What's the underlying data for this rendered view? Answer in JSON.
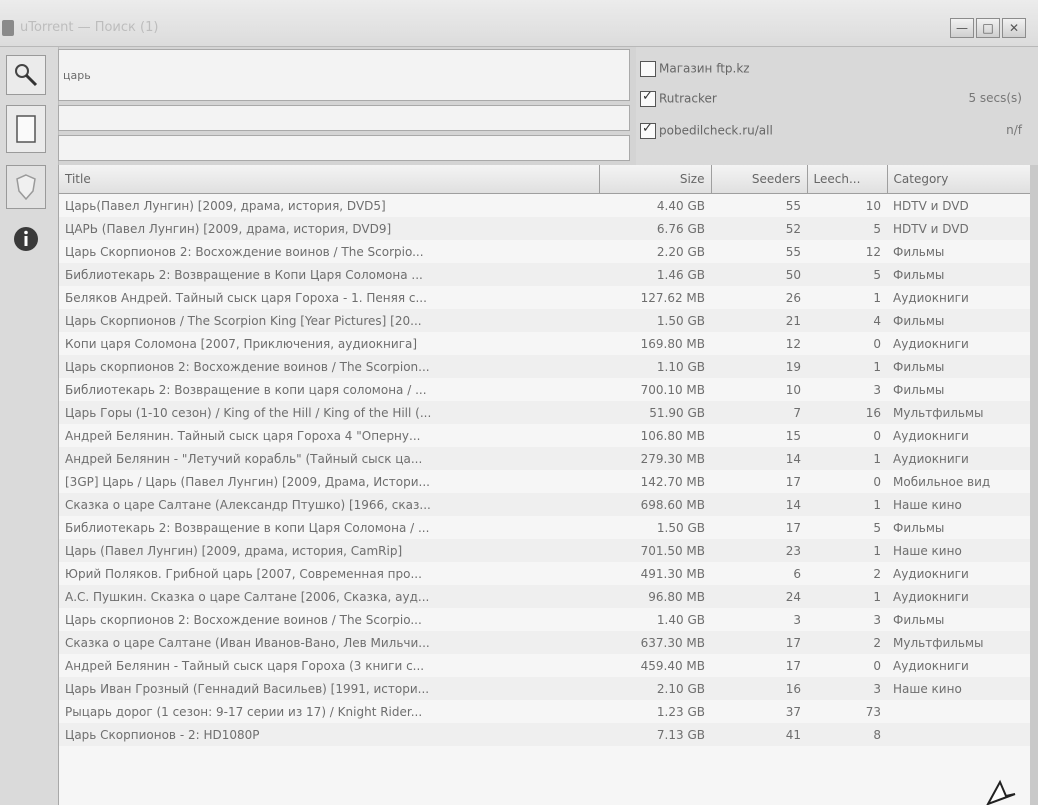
{
  "window": {
    "title": "uTorrent — Поиск (1)",
    "buttons": [
      "—",
      "□",
      "✕"
    ]
  },
  "toolbar": {
    "icons": [
      "search-icon",
      "page-icon",
      "shield-icon",
      "info-icon"
    ]
  },
  "search": {
    "query": "царь",
    "second_field": "",
    "third_field": ""
  },
  "options": {
    "items": [
      {
        "label": "Магазин ftp.kz",
        "checked": false,
        "right": ""
      },
      {
        "label": "Rutracker",
        "checked": true,
        "right": "5 secs(s)"
      },
      {
        "label": "pobedilcheck.ru/all",
        "checked": true,
        "right": "n/f"
      }
    ]
  },
  "table": {
    "columns": [
      "Title",
      "Size",
      "Seeders",
      "Leech...",
      "Category"
    ],
    "rows": [
      [
        "Царь(Павел Лунгин) [2009, драма, история, DVD5]",
        "4.40 GB",
        "55",
        "10",
        "HDTV и DVD"
      ],
      [
        "ЦАРЬ (Павел Лунгин) [2009, драма, история, DVD9]",
        "6.76 GB",
        "52",
        "5",
        "HDTV и DVD"
      ],
      [
        "Царь Скорпионов 2: Восхождение воинов / The Scorpio...",
        "2.20 GB",
        "55",
        "12",
        "Фильмы"
      ],
      [
        "Библиотекарь 2: Возвращение в Копи Царя Соломона ...",
        "1.46 GB",
        "50",
        "5",
        "Фильмы"
      ],
      [
        "Беляков Андрей. Тайный сыск царя Гороха - 1. Пеняя с...",
        "127.62 MB",
        "26",
        "1",
        "Аудиокниги"
      ],
      [
        "Царь Скорпионов / The Scorpion King [Year Pictures] [20...",
        "1.50 GB",
        "21",
        "4",
        "Фильмы"
      ],
      [
        "Копи царя Соломона [2007, Приключения, аудиокнига]",
        "169.80 MB",
        "12",
        "0",
        "Аудиокниги"
      ],
      [
        "Царь скорпионов 2: Восхождение воинов / The Scorpion...",
        "1.10 GB",
        "19",
        "1",
        "Фильмы"
      ],
      [
        "Библиотекарь 2: Возвращение в копи царя соломона / ...",
        "700.10 MB",
        "10",
        "3",
        "Фильмы"
      ],
      [
        "Царь Горы (1-10 сезон) / King of the Hill / King of the Hill (...",
        "51.90 GB",
        "7",
        "16",
        "Мультфильмы"
      ],
      [
        "Андрей Белянин. Тайный сыск царя Гороха 4 \"Оперну...",
        "106.80 MB",
        "15",
        "0",
        "Аудиокниги"
      ],
      [
        "Андрей Белянин - \"Летучий корабль\" (Тайный сыск ца...",
        "279.30 MB",
        "14",
        "1",
        "Аудиокниги"
      ],
      [
        "[3GP] Царь / Царь (Павел Лунгин) [2009, Драма, Истори...",
        "142.70 MB",
        "17",
        "0",
        "Мобильное вид"
      ],
      [
        "Сказка о царе Салтане (Александр Птушко) [1966, сказ...",
        "698.60 MB",
        "14",
        "1",
        "Наше кино"
      ],
      [
        "Библиотекарь 2: Возвращение в копи Царя Соломона / ...",
        "1.50 GB",
        "17",
        "5",
        "Фильмы"
      ],
      [
        "Царь (Павел Лунгин) [2009, драма, история, CamRip]",
        "701.50 MB",
        "23",
        "1",
        "Наше кино"
      ],
      [
        "Юрий Поляков. Грибной царь [2007, Современная про...",
        "491.30 MB",
        "6",
        "2",
        "Аудиокниги"
      ],
      [
        "А.С. Пушкин. Сказка о царе Салтане [2006, Сказка, ауд...",
        "96.80 MB",
        "24",
        "1",
        "Аудиокниги"
      ],
      [
        "Царь скорпионов 2: Восхождение воинов / The Scorpio...",
        "1.40 GB",
        "3",
        "3",
        "Фильмы"
      ],
      [
        "Сказка о царе Салтане (Иван Иванов-Вано, Лев Мильчи...",
        "637.30 MB",
        "17",
        "2",
        "Мультфильмы"
      ],
      [
        "Андрей Белянин - Тайный сыск царя Гороха (3 книги с...",
        "459.40 MB",
        "17",
        "0",
        "Аудиокниги"
      ],
      [
        "Царь Иван Грозный (Геннадий Васильев) [1991, истори...",
        "2.10 GB",
        "16",
        "3",
        "Наше кино"
      ],
      [
        "Рыцарь дорог (1 сезон: 9-17 серии из 17) / Knight Rider...",
        "1.23 GB",
        "37",
        "73",
        ""
      ],
      [
        "Царь Скорпионов - 2: HD1080P",
        "7.13 GB",
        "41",
        "8",
        ""
      ]
    ]
  }
}
